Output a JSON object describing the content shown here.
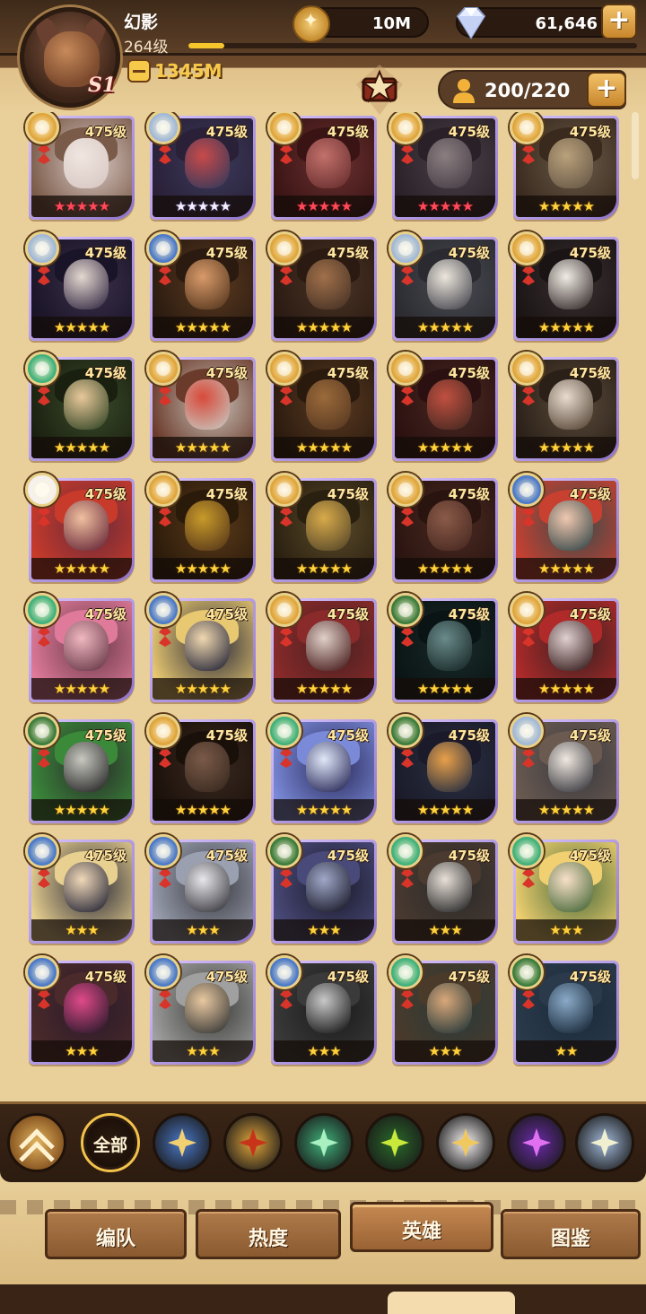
{
  "player": {
    "name": "幻影",
    "level": "264级",
    "exp_fraction": 0.08,
    "season_badge": "S1",
    "power": "1345M"
  },
  "currency": {
    "gold": "10M",
    "gems": "61,646",
    "gold_icon": "gold-coin-icon",
    "gem_icon": "diamond-icon",
    "plus_label": "+"
  },
  "hero_capacity": {
    "value": "200/220",
    "icon": "person-icon",
    "plus_label": "+"
  },
  "colors": {
    "red_star": "#ff4a5a",
    "white_star": "#f4f0ff",
    "gold_star": "#ffd23c",
    "light_faction": "#f2b23a",
    "mauler_faction": "#e0a43a",
    "lightbearer_faction": "#4a78c8",
    "wilder_faction": "#3fb07a",
    "graveborn_faction": "#3a7a3a",
    "celestial_faction": "#f4f0f0",
    "hypogean_faction": "#8a3ac8",
    "dimensional_faction": "#a0b8d8"
  },
  "heroes": [
    {
      "level": "475级",
      "stars": "★★★★★",
      "star_type": "red",
      "faction": "mauler",
      "palette": [
        "#d8c8c4",
        "#f0e6e0",
        "#7a5a48"
      ]
    },
    {
      "level": "475级",
      "stars": "★★★★★",
      "star_type": "white",
      "faction": "dimensional",
      "palette": [
        "#3a3a5a",
        "#c84a4a",
        "#2a2038"
      ]
    },
    {
      "level": "475级",
      "stars": "★★★★★",
      "star_type": "red",
      "faction": "mauler",
      "palette": [
        "#6a3030",
        "#c2706a",
        "#3a1414"
      ]
    },
    {
      "level": "475级",
      "stars": "★★★★★",
      "star_type": "red",
      "faction": "mauler",
      "palette": [
        "#4a4048",
        "#8a7e80",
        "#2a2028"
      ]
    },
    {
      "level": "475级",
      "stars": "★★★★★",
      "star_type": "gold",
      "faction": "mauler",
      "palette": [
        "#6a5a48",
        "#b8a07a",
        "#3a2a1e"
      ]
    },
    {
      "level": "475级",
      "stars": "★★★★★",
      "star_type": "gold",
      "faction": "dimensional",
      "palette": [
        "#3a3048",
        "#e4d8d0",
        "#1a1428"
      ]
    },
    {
      "level": "475级",
      "stars": "★★★★★",
      "star_type": "gold",
      "faction": "lightbearer",
      "palette": [
        "#5a3a20",
        "#d89a6a",
        "#2a1a10"
      ]
    },
    {
      "level": "475级",
      "stars": "★★★★★",
      "star_type": "gold",
      "faction": "mauler",
      "palette": [
        "#4a3426",
        "#a0704a",
        "#2a1a12"
      ]
    },
    {
      "level": "475级",
      "stars": "★★★★★",
      "star_type": "gold",
      "faction": "dimensional",
      "palette": [
        "#4a4a52",
        "#ece6dc",
        "#2a2a30"
      ]
    },
    {
      "level": "475级",
      "stars": "★★★★★",
      "star_type": "gold",
      "faction": "mauler",
      "palette": [
        "#3a3030",
        "#f0ece4",
        "#1a1414"
      ]
    },
    {
      "level": "475级",
      "stars": "★★★★★",
      "star_type": "gold",
      "faction": "wilder",
      "palette": [
        "#3a4a2a",
        "#e8c89a",
        "#1a2010"
      ]
    },
    {
      "level": "475级",
      "stars": "★★★★★",
      "star_type": "gold",
      "faction": "mauler",
      "palette": [
        "#c8c0b8",
        "#d84a3a",
        "#6a3a2a"
      ]
    },
    {
      "level": "475级",
      "stars": "★★★★★",
      "star_type": "gold",
      "faction": "mauler",
      "palette": [
        "#5a3a22",
        "#9a6a3a",
        "#2a1a0e"
      ]
    },
    {
      "level": "475级",
      "stars": "★★★★★",
      "star_type": "gold",
      "faction": "mauler",
      "palette": [
        "#4a2a22",
        "#c05040",
        "#2a1010"
      ]
    },
    {
      "level": "475级",
      "stars": "★★★★★",
      "star_type": "gold",
      "faction": "mauler",
      "palette": [
        "#5a4a3a",
        "#e8dcd0",
        "#2a2018"
      ]
    },
    {
      "level": "475级",
      "stars": "★★★★★",
      "star_type": "gold",
      "faction": "celestial",
      "palette": [
        "#6a2a3a",
        "#f0c0a0",
        "#c83a2a"
      ]
    },
    {
      "level": "475级",
      "stars": "★★★★★",
      "star_type": "gold",
      "faction": "mauler",
      "palette": [
        "#5a3a1a",
        "#c89a2a",
        "#2a1a0a"
      ]
    },
    {
      "level": "475级",
      "stars": "★★★★★",
      "star_type": "gold",
      "faction": "mauler",
      "palette": [
        "#5a4a2a",
        "#d8aa4a",
        "#2a2010"
      ]
    },
    {
      "level": "475级",
      "stars": "★★★★★",
      "star_type": "gold",
      "faction": "mauler",
      "palette": [
        "#4a2a22",
        "#8a5a48",
        "#2a1410"
      ]
    },
    {
      "level": "475级",
      "stars": "★★★★★",
      "star_type": "gold",
      "faction": "lightbearer",
      "palette": [
        "#3a4a4a",
        "#f0c8b0",
        "#c84030"
      ]
    },
    {
      "level": "475级",
      "stars": "★★★★★",
      "star_type": "gold",
      "faction": "wilder",
      "palette": [
        "#6a3a4a",
        "#f0b8c0",
        "#e07a9a"
      ]
    },
    {
      "level": "475级",
      "stars": "★★★★★",
      "star_type": "gold",
      "faction": "lightbearer",
      "palette": [
        "#2a2a3a",
        "#f0d8b0",
        "#e8c870"
      ]
    },
    {
      "level": "475级",
      "stars": "★★★★★",
      "star_type": "gold",
      "faction": "mauler",
      "palette": [
        "#4a2020",
        "#e0d0c8",
        "#8a2a2a"
      ]
    },
    {
      "level": "475级",
      "stars": "★★★★★",
      "star_type": "gold",
      "faction": "graveborn",
      "palette": [
        "#1a2a2a",
        "#6a8a8a",
        "#0a1414"
      ]
    },
    {
      "level": "475级",
      "stars": "★★★★★",
      "star_type": "gold",
      "faction": "mauler",
      "palette": [
        "#3a2020",
        "#e0d0d0",
        "#b02a2a"
      ]
    },
    {
      "level": "475级",
      "stars": "★★★★★",
      "star_type": "gold",
      "faction": "graveborn",
      "palette": [
        "#2a2a2a",
        "#c8c8c0",
        "#3a8a3a"
      ]
    },
    {
      "level": "475级",
      "stars": "★★★★★",
      "star_type": "gold",
      "faction": "mauler",
      "palette": [
        "#3a2a20",
        "#7a5a48",
        "#1a100a"
      ]
    },
    {
      "level": "475级",
      "stars": "★★★★★",
      "star_type": "gold",
      "faction": "wilder",
      "palette": [
        "#2a2a5a",
        "#e0e8f8",
        "#7a8ad8"
      ]
    },
    {
      "level": "475级",
      "stars": "★★★★★",
      "star_type": "gold",
      "faction": "graveborn",
      "palette": [
        "#2a3040",
        "#e8a04a",
        "#1a1a2a"
      ]
    },
    {
      "level": "475级",
      "stars": "★★★★★",
      "star_type": "gold",
      "faction": "dimensional",
      "palette": [
        "#3a3a40",
        "#f0e8e0",
        "#6a5a50"
      ]
    },
    {
      "level": "475级",
      "stars": "★★★",
      "star_type": "gold",
      "faction": "lightbearer",
      "palette": [
        "#2a2a38",
        "#f0d8b8",
        "#e8d090"
      ]
    },
    {
      "level": "475级",
      "stars": "★★★",
      "star_type": "gold",
      "faction": "lightbearer",
      "palette": [
        "#3a3a40",
        "#e8e8ec",
        "#9aa0b0"
      ]
    },
    {
      "level": "475级",
      "stars": "★★★",
      "star_type": "gold",
      "faction": "graveborn",
      "palette": [
        "#1a1a2a",
        "#a0a8c8",
        "#4a4a7a"
      ]
    },
    {
      "level": "475级",
      "stars": "★★★",
      "star_type": "gold",
      "faction": "wilder",
      "palette": [
        "#2a2a2a",
        "#e8e0d8",
        "#4a3a30"
      ]
    },
    {
      "level": "475级",
      "stars": "★★★",
      "star_type": "gold",
      "faction": "wilder",
      "palette": [
        "#4a6a3a",
        "#f8e0c8",
        "#f0d070"
      ]
    },
    {
      "level": "475级",
      "stars": "★★★",
      "star_type": "gold",
      "faction": "lightbearer",
      "palette": [
        "#2a1a2a",
        "#e04a8a",
        "#4a2a2a"
      ]
    },
    {
      "level": "475级",
      "stars": "★★★",
      "star_type": "gold",
      "faction": "lightbearer",
      "palette": [
        "#3a3a38",
        "#e8c8a0",
        "#a0a0a0"
      ]
    },
    {
      "level": "475级",
      "stars": "★★★",
      "star_type": "gold",
      "faction": "lightbearer",
      "palette": [
        "#1a1a1a",
        "#c8c8c8",
        "#3a3a3a"
      ]
    },
    {
      "level": "475级",
      "stars": "★★★",
      "star_type": "gold",
      "faction": "wilder",
      "palette": [
        "#2a3a3a",
        "#d8a87a",
        "#4a3a2a"
      ]
    },
    {
      "level": "475级",
      "stars": "★★",
      "star_type": "gold",
      "faction": "graveborn",
      "palette": [
        "#1a2a3a",
        "#8aaac8",
        "#2a3a4a"
      ]
    }
  ],
  "faction_filters": [
    {
      "name": "lightbearer",
      "color": "#4a78c8",
      "core": "#f0d070"
    },
    {
      "name": "mauler",
      "color": "#e0a43a",
      "core": "#c8341a"
    },
    {
      "name": "wilder",
      "color": "#3fb07a",
      "core": "#a8f0c0"
    },
    {
      "name": "graveborn",
      "color": "#2a6a2a",
      "core": "#c8e83a"
    },
    {
      "name": "celestial",
      "color": "#f4f0f0",
      "core": "#f0c860"
    },
    {
      "name": "hypogean",
      "color": "#6a2aa8",
      "core": "#e070f0"
    },
    {
      "name": "dimensional",
      "color": "#a0b8d8",
      "core": "#f0f0d0"
    }
  ],
  "filter_all_label": "全部",
  "tabs": [
    {
      "label": "编队"
    },
    {
      "label": "热度"
    },
    {
      "label": "英雄"
    },
    {
      "label": "图鉴"
    }
  ]
}
